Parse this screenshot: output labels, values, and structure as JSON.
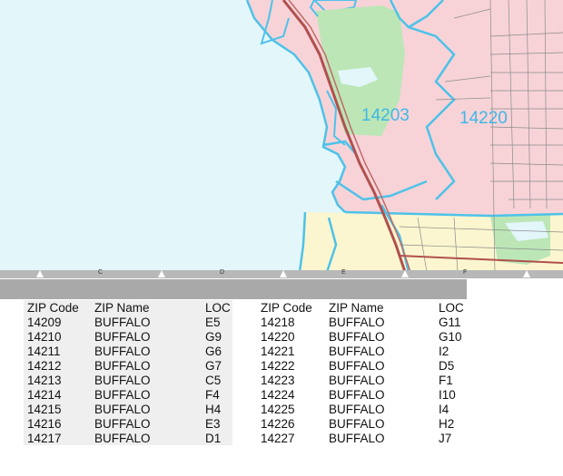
{
  "map": {
    "zip_labels": [
      "14203",
      "14220"
    ],
    "colors": {
      "water": "#e3f6fa",
      "zip_pink": "#f7d3d8",
      "zip_yellow": "#fbf6cf",
      "park_green": "#bce6b6",
      "boundary": "#4ec2e8",
      "highway": "#b0504e"
    }
  },
  "ruler": {
    "labels": [
      "C",
      "D",
      "E",
      "F"
    ]
  },
  "table": {
    "headers": [
      "ZIP Code",
      "ZIP Name",
      "LOC",
      "ZIP Code",
      "ZIP Name",
      "LOC"
    ],
    "left_rows": [
      [
        "14209",
        "BUFFALO",
        "E5"
      ],
      [
        "14210",
        "BUFFALO",
        "G9"
      ],
      [
        "14211",
        "BUFFALO",
        "G6"
      ],
      [
        "14212",
        "BUFFALO",
        "G7"
      ],
      [
        "14213",
        "BUFFALO",
        "C5"
      ],
      [
        "14214",
        "BUFFALO",
        "F4"
      ],
      [
        "14215",
        "BUFFALO",
        "H4"
      ],
      [
        "14216",
        "BUFFALO",
        "E3"
      ],
      [
        "14217",
        "BUFFALO",
        "D1"
      ]
    ],
    "right_rows": [
      [
        "14218",
        "BUFFALO",
        "G11"
      ],
      [
        "14220",
        "BUFFALO",
        "G10"
      ],
      [
        "14221",
        "BUFFALO",
        "I2"
      ],
      [
        "14222",
        "BUFFALO",
        "D5"
      ],
      [
        "14223",
        "BUFFALO",
        "F1"
      ],
      [
        "14224",
        "BUFFALO",
        "I10"
      ],
      [
        "14225",
        "BUFFALO",
        "I4"
      ],
      [
        "14226",
        "BUFFALO",
        "H2"
      ],
      [
        "14227",
        "BUFFALO",
        "J7"
      ]
    ]
  }
}
